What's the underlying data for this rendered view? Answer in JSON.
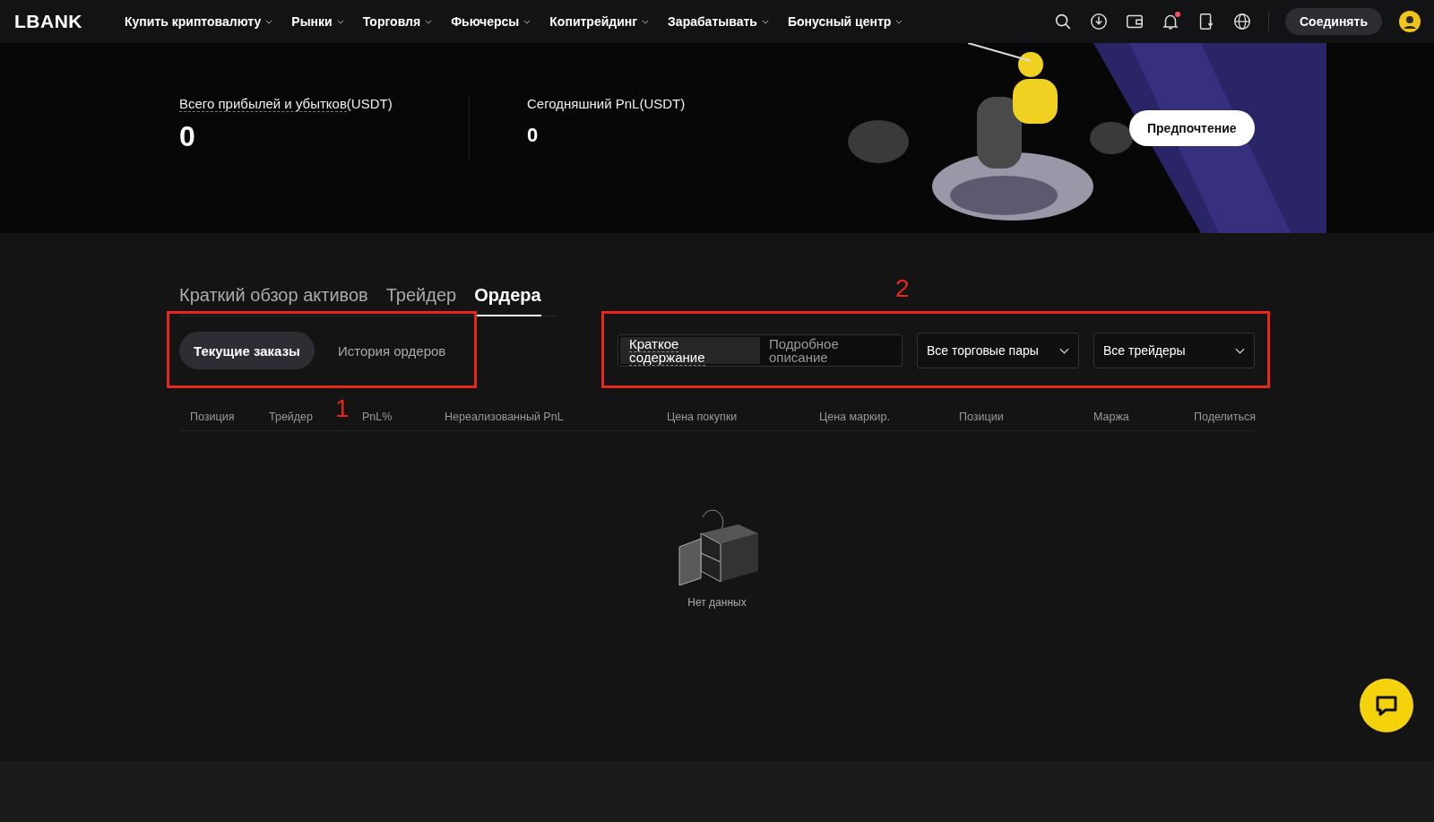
{
  "header": {
    "logo": "LBANK",
    "nav": [
      {
        "label": "Купить криптовалюту",
        "dropdown": true
      },
      {
        "label": "Рынки",
        "dropdown": true
      },
      {
        "label": "Торговля",
        "dropdown": true
      },
      {
        "label": "Фьючерсы",
        "dropdown": true
      },
      {
        "label": "Копитрейдинг",
        "dropdown": true
      },
      {
        "label": "Зарабатывать",
        "dropdown": true
      },
      {
        "label": "Бонусный центр",
        "dropdown": true
      }
    ],
    "notifications_unread": true,
    "connect_button": "Соединять"
  },
  "summary": {
    "stats": [
      {
        "label": "Всего прибылей и убытков",
        "unit": "(USDT)",
        "value": "0",
        "dashed_underline": true
      },
      {
        "label": "Сегодняшний PnL",
        "unit": "(USDT)",
        "value": "0",
        "dashed_underline": false
      }
    ],
    "preference_button": "Предпочтение"
  },
  "tabs": [
    {
      "label": "Краткий обзор активов",
      "selected": false
    },
    {
      "label": "Трейдер",
      "selected": false
    },
    {
      "label": "Ордера",
      "selected": true
    }
  ],
  "subtabs": [
    {
      "label": "Текущие заказы",
      "selected": true
    },
    {
      "label": "История ордеров",
      "selected": false
    }
  ],
  "view_toggle": [
    {
      "label": "Краткое содержание",
      "selected": true
    },
    {
      "label": "Подробное описание",
      "selected": false
    }
  ],
  "filters": [
    {
      "value": "Все торговые пары"
    },
    {
      "value": "Все трейдеры"
    }
  ],
  "table": {
    "columns": [
      "Позиция",
      "Трейдер",
      "PnL%",
      "Нереализованный PnL",
      "Цена покупки",
      "Цена маркир.",
      "Позиции",
      "Маржа",
      "Поделиться"
    ],
    "empty_text": "Нет данных"
  },
  "annotations": [
    {
      "label": "1"
    },
    {
      "label": "2"
    }
  ]
}
